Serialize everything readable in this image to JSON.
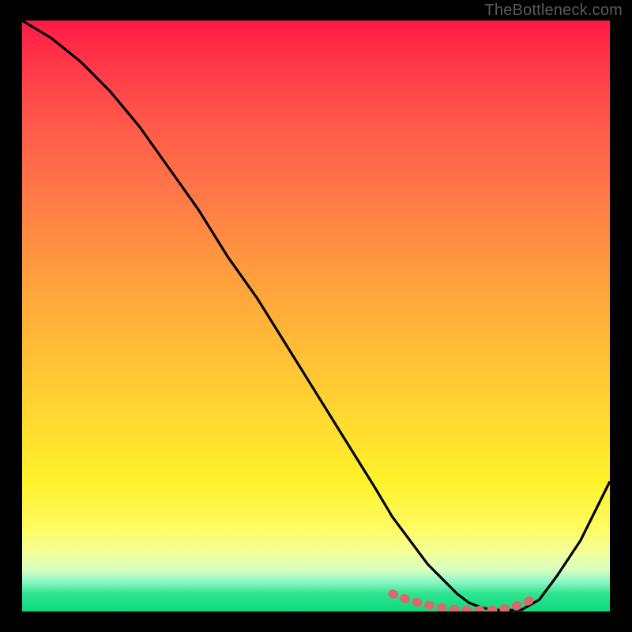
{
  "watermark": "TheBottleneck.com",
  "chart_data": {
    "type": "line",
    "title": "",
    "xlabel": "",
    "ylabel": "",
    "xlim": [
      0,
      100
    ],
    "ylim": [
      0,
      100
    ],
    "series": [
      {
        "name": "curve",
        "x": [
          0,
          5,
          10,
          15,
          20,
          25,
          30,
          35,
          40,
          45,
          50,
          55,
          60,
          63,
          66,
          69,
          72,
          74,
          76,
          78,
          80,
          82,
          85,
          88,
          91,
          95,
          100
        ],
        "y": [
          100,
          97,
          93,
          88,
          82,
          75,
          68,
          60,
          53,
          45,
          37,
          29,
          21,
          16,
          12,
          8,
          5,
          3,
          1.5,
          0.7,
          0.3,
          0.2,
          0.3,
          2,
          6,
          12,
          22
        ]
      },
      {
        "name": "marker-band",
        "x": [
          63,
          65,
          67,
          69,
          71,
          73,
          75,
          77,
          79,
          81,
          83,
          85,
          87
        ],
        "y": [
          3,
          2.2,
          1.6,
          1.1,
          0.7,
          0.4,
          0.25,
          0.2,
          0.22,
          0.3,
          0.6,
          1.2,
          2.2
        ]
      }
    ],
    "gradient": {
      "top": "#ff1a44",
      "mid": "#ffd431",
      "bottom": "#0ed97e"
    },
    "marker_color": "#d86a6e",
    "curve_color": "#000000"
  }
}
